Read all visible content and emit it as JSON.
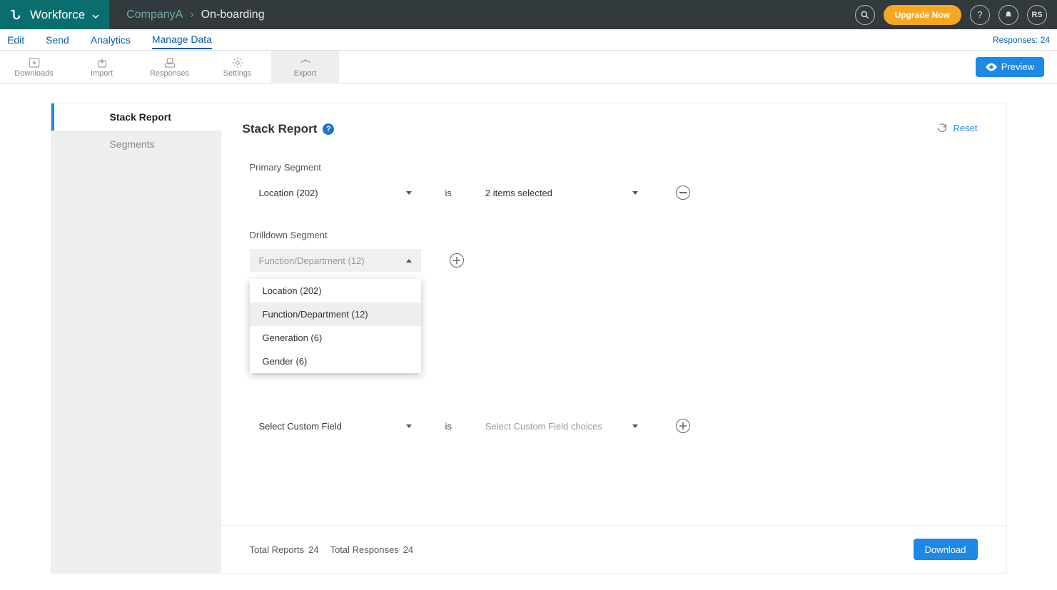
{
  "topbar": {
    "brand": "Workforce",
    "breadcrumb_company": "CompanyA",
    "breadcrumb_page": "On-boarding",
    "upgrade": "Upgrade Now",
    "avatar": "RS"
  },
  "tabs": {
    "edit": "Edit",
    "send": "Send",
    "analytics": "Analytics",
    "manage": "Manage Data",
    "responses": "Responses: 24"
  },
  "toolbar": {
    "downloads": "Downloads",
    "import": "Import",
    "responses": "Responses",
    "settings": "Settings",
    "export": "Export",
    "preview": "Preview"
  },
  "sidebar": {
    "stack_report": "Stack Report",
    "segments": "Segments"
  },
  "main": {
    "title": "Stack Report",
    "reset": "Reset",
    "primary_label": "Primary Segment",
    "primary_value": "Location (202)",
    "is_word": "is",
    "primary_selected": "2 items selected",
    "drilldown_label": "Drilldown Segment",
    "drilldown_value": "Function/Department (12)",
    "dropdown": {
      "opt1": "Location (202)",
      "opt2": "Function/Department (12)",
      "opt3": "Generation (6)",
      "opt4": "Gender (6)"
    },
    "custom_field": "Select Custom Field",
    "custom_choices": "Select Custom Field choices",
    "total_reports_label": "Total Reports",
    "total_reports_value": "24",
    "total_responses_label": "Total Responses",
    "total_responses_value": "24",
    "download": "Download"
  }
}
